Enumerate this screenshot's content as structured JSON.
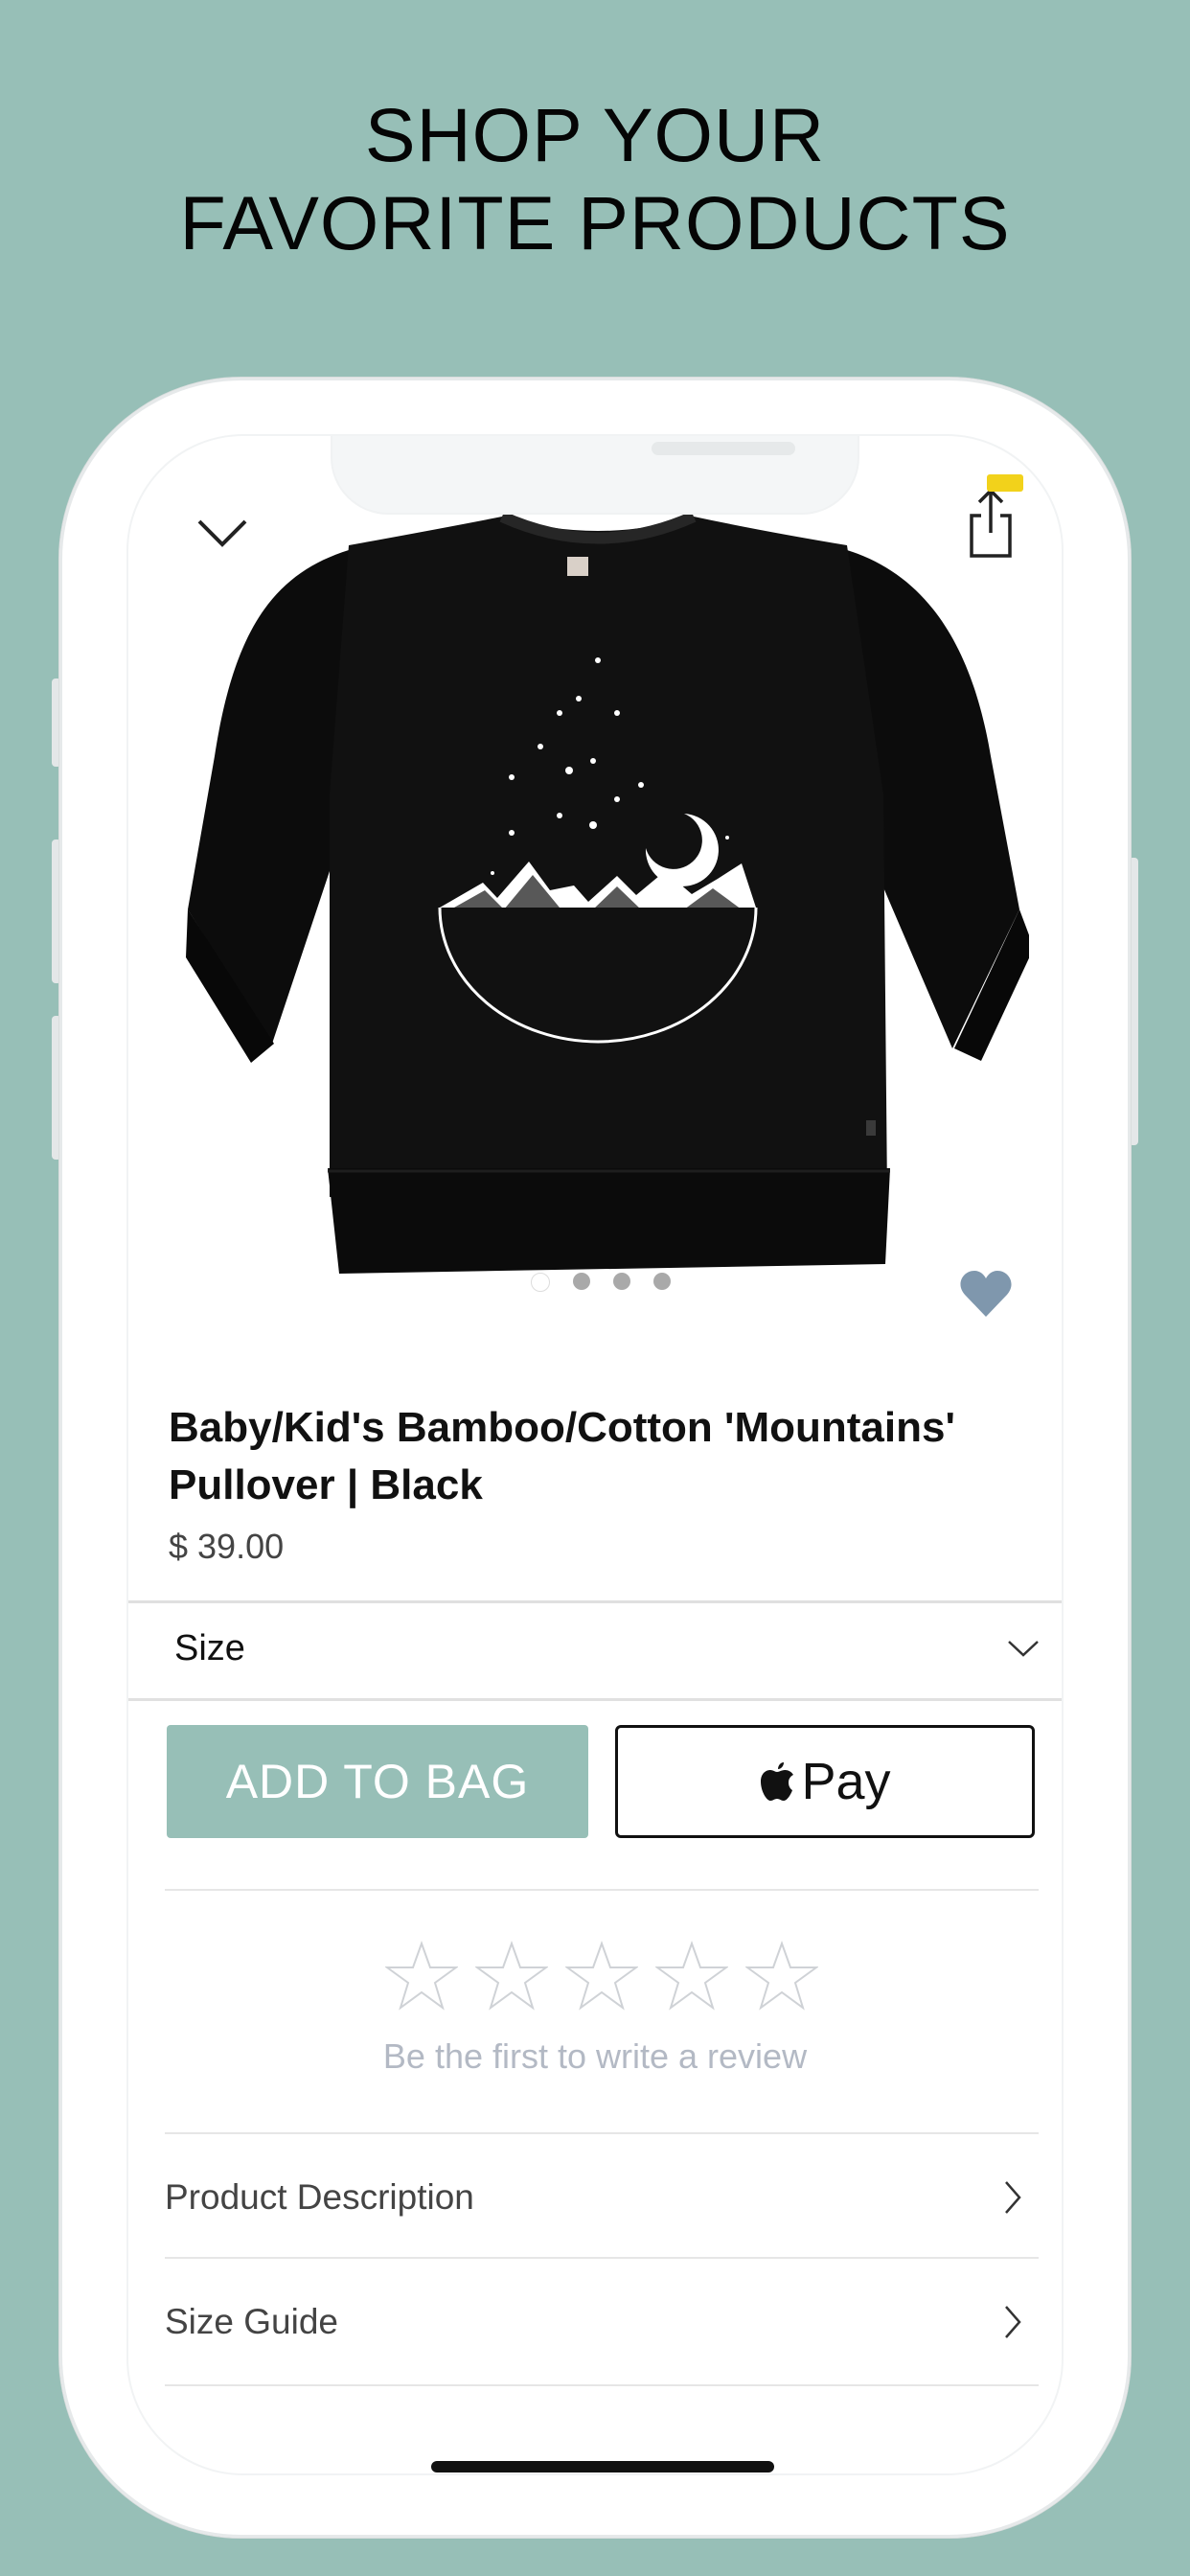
{
  "headline": {
    "line1": "SHOP YOUR",
    "line2": "FAVORITE PRODUCTS"
  },
  "colors": {
    "background": "#97bfb7",
    "accent": "#97bfb7",
    "badge": "#f2d21b",
    "heart": "#7f97ad"
  },
  "product": {
    "title": "Baby/Kid's Bamboo/Cotton 'Mountains' Pullover | Black",
    "price": "$ 39.00",
    "image_icon": "black-pullover-mountains-image",
    "carousel": {
      "count": 4,
      "active_index": 0
    }
  },
  "size_selector": {
    "label": "Size",
    "icon": "chevron-down-icon"
  },
  "actions": {
    "add_to_bag": "ADD TO BAG",
    "apple_pay": "Pay"
  },
  "reviews": {
    "rating": 0,
    "max_rating": 5,
    "cta": "Be the first to write a review"
  },
  "sections": [
    {
      "label": "Product Description",
      "icon": "chevron-right-icon"
    },
    {
      "label": "Size Guide",
      "icon": "chevron-right-icon"
    }
  ],
  "toolbar": {
    "collapse_icon": "chevron-down-icon",
    "share_icon": "share-icon",
    "favorite_icon": "heart-icon"
  }
}
